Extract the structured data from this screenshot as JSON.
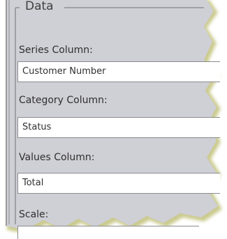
{
  "panel": {
    "legend": "Data",
    "background": "#cfcfd6"
  },
  "fields": [
    {
      "label": "Series Column:",
      "value": "Customer Number"
    },
    {
      "label": "Category Column:",
      "value": "Status"
    },
    {
      "label": "Values Column:",
      "value": "Total"
    },
    {
      "label": "Scale:",
      "value": ""
    }
  ]
}
